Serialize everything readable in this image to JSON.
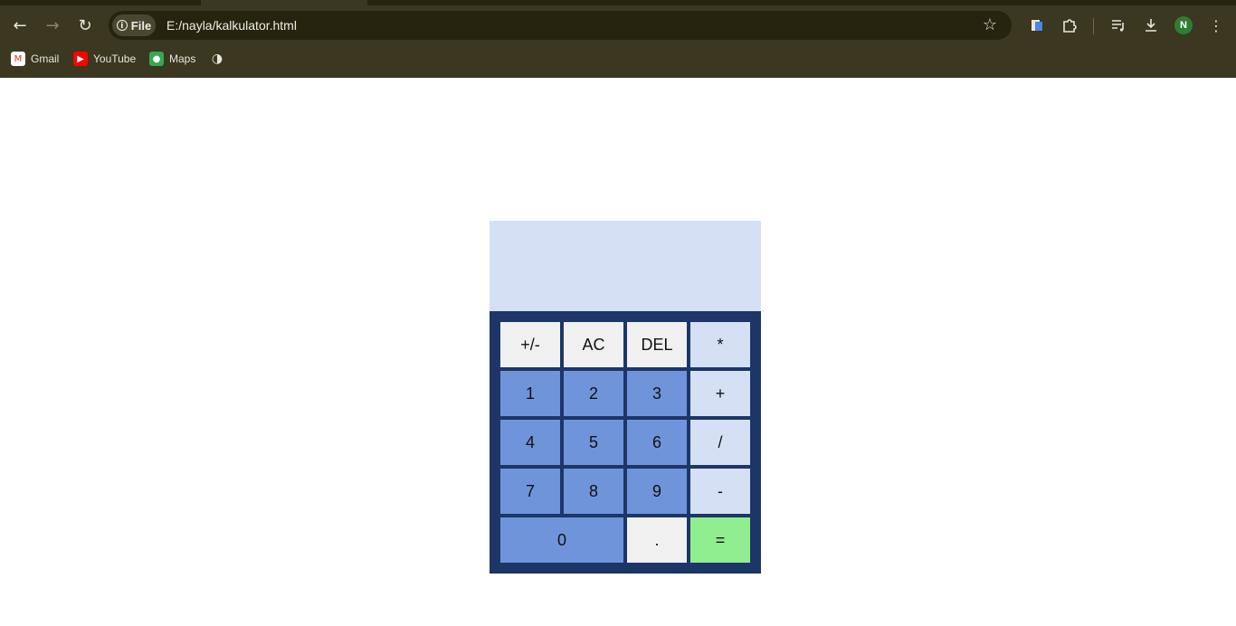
{
  "browser": {
    "site_chip_label": "File",
    "url": "E:/nayla/kalkulator.html",
    "profile_initial": "N",
    "bookmarks": [
      {
        "label": "Gmail",
        "icon": "gmail-icon"
      },
      {
        "label": "YouTube",
        "icon": "youtube-icon"
      },
      {
        "label": "Maps",
        "icon": "maps-icon"
      },
      {
        "label": "",
        "icon": "globe-icon"
      }
    ],
    "toolbar_icons": [
      "back-icon",
      "forward-icon",
      "reload-icon",
      "bookmark-star-icon",
      "docs-extension-icon",
      "extensions-puzzle-icon",
      "reading-list-icon",
      "download-icon",
      "avatar",
      "menu-kebab-icon"
    ]
  },
  "calculator": {
    "display_value": "",
    "keys": {
      "negate": "+/-",
      "clear": "AC",
      "delete": "DEL",
      "multiply": "*",
      "one": "1",
      "two": "2",
      "three": "3",
      "add": "+",
      "four": "4",
      "five": "5",
      "six": "6",
      "divide": "/",
      "seven": "7",
      "eight": "8",
      "nine": "9",
      "subtract": "-",
      "zero": "0",
      "decimal": ".",
      "equals": "="
    },
    "colors": {
      "frame": "#1c3668",
      "display_bg": "#d5e0f4",
      "number_key": "#6f94da",
      "operator_key": "#d5e0f4",
      "function_key": "#f0f0f0",
      "equals_key": "#90ee90"
    }
  }
}
